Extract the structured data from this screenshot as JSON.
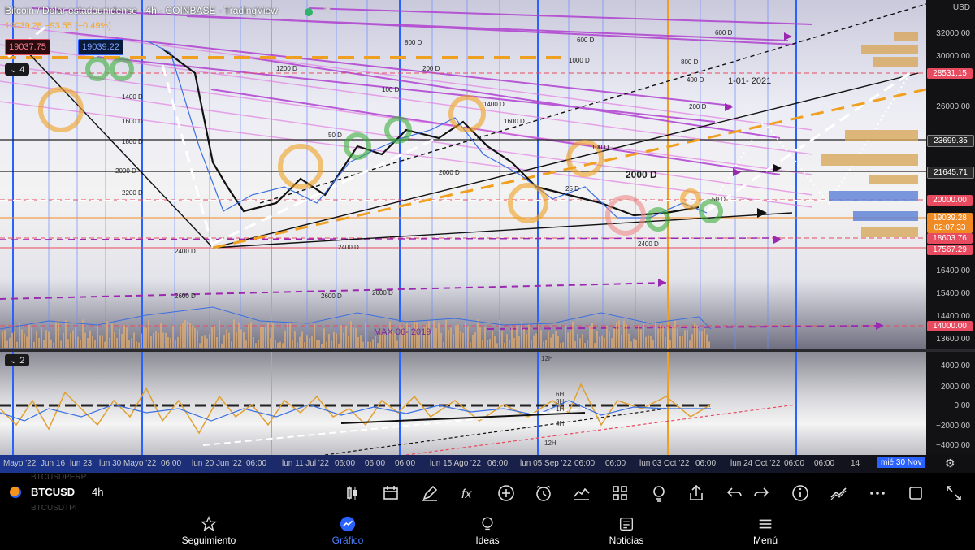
{
  "header": {
    "symbol_title": "Bitcoin / Dólar estadounidense · 4h · COINBASE · TradingView",
    "ohlc_line": "19039.28 −93.55 (−0.49%)",
    "sell_price": "19037.75",
    "spread": "1.47",
    "buy_price": "19039.22",
    "main_pane_label": "4",
    "osc_pane_label": "2"
  },
  "price_axis": {
    "currency": "USD",
    "labels": [
      "32000.00",
      "30000.00",
      "26000.00",
      "16400.00",
      "15400.00",
      "14400.00",
      "13600.00"
    ],
    "tags": [
      {
        "value": "28531.15",
        "color": "#e84a5f"
      },
      {
        "value": "23699.35",
        "color": "#2a2a2a"
      },
      {
        "value": "21645.71",
        "color": "#2a2a2a"
      },
      {
        "value": "20000.00",
        "color": "#e84a5f"
      },
      {
        "value": "19039.28",
        "color": "#f08a24"
      },
      {
        "value": "02:07:33",
        "color": "#f08a24"
      },
      {
        "value": "18603.76",
        "color": "#e84a5f"
      },
      {
        "value": "17567.29",
        "color": "#e84a5f"
      },
      {
        "value": "14000.00",
        "color": "#e84a5f"
      }
    ]
  },
  "osc_axis": {
    "labels": [
      "4000.00",
      "2000.00",
      "0.00",
      "−2000.00",
      "−4000.00"
    ]
  },
  "chart_annotations": {
    "date_note": "1-01- 2021",
    "max_note": "MAX 06- 2019",
    "big_label": "2000 D",
    "d_labels": [
      "2400 D",
      "2600 D",
      "2600 D",
      "2400 D",
      "2600 D",
      "2400 D",
      "1400 D",
      "1600 D",
      "1800 D",
      "2000 D",
      "2200 D",
      "1000 D",
      "800 D",
      "600 D",
      "400 D",
      "200 D",
      "100 D",
      "50 D",
      "1400 D",
      "1600 D",
      "1200 D",
      "600 D",
      "800 D",
      "200 D",
      "100 D",
      "50 D",
      "2000 D",
      "25 D"
    ],
    "osc_marks": [
      "12H",
      "6H",
      "3H",
      "1H",
      "4H",
      "12H"
    ]
  },
  "time_axis": {
    "labels": [
      "Mayo '22",
      "Jun 16",
      "lun 23",
      "lun 30 Mayo '22",
      "06:00",
      "lun 20 Jun '22",
      "06:00",
      "lun 11 Jul '22",
      "06:00",
      "06:00",
      "06:00",
      "lun 15 Ago '22",
      "06:00",
      "lun 05 Sep '22",
      "06:00",
      "06:00",
      "lun 03 Oct '22",
      "06:00",
      "lun 24 Oct '22",
      "06:00",
      "06:00",
      "14",
      "mié 30 Nov"
    ]
  },
  "toolbar": {
    "symbol": "BTCUSD",
    "interval": "4h",
    "ghost_symbol_above": "BTCUSDPERP",
    "ghost_symbol_below": "BTCUSDTPI",
    "icons": [
      "candles-icon",
      "compare-icon",
      "draw-icon",
      "indicators-icon",
      "add-icon",
      "alert-icon",
      "replay-icon",
      "layouts-icon",
      "ideas-bulb-icon",
      "share-icon",
      "undo-icon",
      "redo-icon",
      "info-icon",
      "trend-icon",
      "more-icon",
      "fullscreen-box-icon",
      "expand-icon"
    ]
  },
  "bottom_nav": [
    {
      "label": "Seguimiento",
      "icon": "star-icon",
      "active": false
    },
    {
      "label": "Gráfico",
      "icon": "chart-icon",
      "active": true
    },
    {
      "label": "Ideas",
      "icon": "bulb-icon",
      "active": false
    },
    {
      "label": "Noticias",
      "icon": "news-icon",
      "active": false
    },
    {
      "label": "Menú",
      "icon": "menu-icon",
      "active": false
    }
  ],
  "colors": {
    "accent_blue": "#2962ff",
    "orange": "#f0a020",
    "red_tag": "#e84a5f",
    "purple": "#9c27b0"
  }
}
